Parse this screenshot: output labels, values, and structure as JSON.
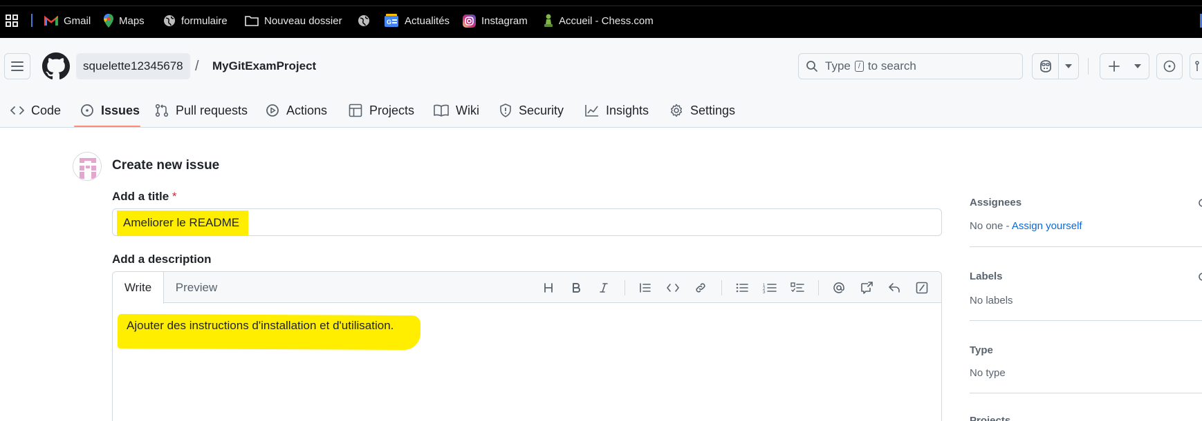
{
  "bookmarks": [
    {
      "label": "Gmail",
      "icon": "gmail-icon"
    },
    {
      "label": "Maps",
      "icon": "maps-pin-icon"
    },
    {
      "label": "formulaire",
      "icon": "globe-icon"
    },
    {
      "label": "Nouveau dossier",
      "icon": "folder-icon"
    },
    {
      "label": "",
      "icon": "globe-icon"
    },
    {
      "label": "Actualités",
      "icon": "google-news-icon"
    },
    {
      "label": "Instagram",
      "icon": "instagram-icon"
    },
    {
      "label": "Accueil - Chess.com",
      "icon": "chess-pawn-icon"
    }
  ],
  "header": {
    "owner": "squelette12345678",
    "separator": "/",
    "repo": "MyGitExamProject",
    "search": {
      "prefix": "Type",
      "key": "/",
      "suffix": "to search"
    }
  },
  "tabs": [
    {
      "label": "Code",
      "icon": "code-icon",
      "active": false
    },
    {
      "label": "Issues",
      "icon": "issue-opened-icon",
      "active": true
    },
    {
      "label": "Pull requests",
      "icon": "git-pull-request-icon",
      "active": false
    },
    {
      "label": "Actions",
      "icon": "play-icon",
      "active": false
    },
    {
      "label": "Projects",
      "icon": "table-icon",
      "active": false
    },
    {
      "label": "Wiki",
      "icon": "book-icon",
      "active": false
    },
    {
      "label": "Security",
      "icon": "shield-icon",
      "active": false
    },
    {
      "label": "Insights",
      "icon": "graph-icon",
      "active": false
    },
    {
      "label": "Settings",
      "icon": "gear-icon",
      "active": false
    }
  ],
  "form": {
    "page_title": "Create new issue",
    "title_label": "Add a title",
    "required_mark": "*",
    "title_value": "Ameliorer le README",
    "description_label": "Add a description",
    "write_tab": "Write",
    "preview_tab": "Preview",
    "description_value": "Ajouter des instructions d'installation et d'utilisation.",
    "highlight_color": "#ffee00"
  },
  "toolbar_icons": [
    "heading-icon",
    "bold-icon",
    "italic-icon",
    "quote-icon",
    "code-icon",
    "link-icon",
    "bullet-list-icon",
    "numbered-list-icon",
    "task-list-icon",
    "mention-icon",
    "cross-reference-icon",
    "reply-icon",
    "slash-command-icon"
  ],
  "sidebar": {
    "assignees_title": "Assignees",
    "assignees_value": "No one",
    "assignees_dash": " - ",
    "assign_yourself": "Assign yourself",
    "labels_title": "Labels",
    "labels_value": "No labels",
    "type_title": "Type",
    "type_value": "No type",
    "projects_title": "Projects"
  },
  "colors": {
    "accent_underline": "#fd8c73",
    "link": "#0969da",
    "required": "#d1242f"
  }
}
